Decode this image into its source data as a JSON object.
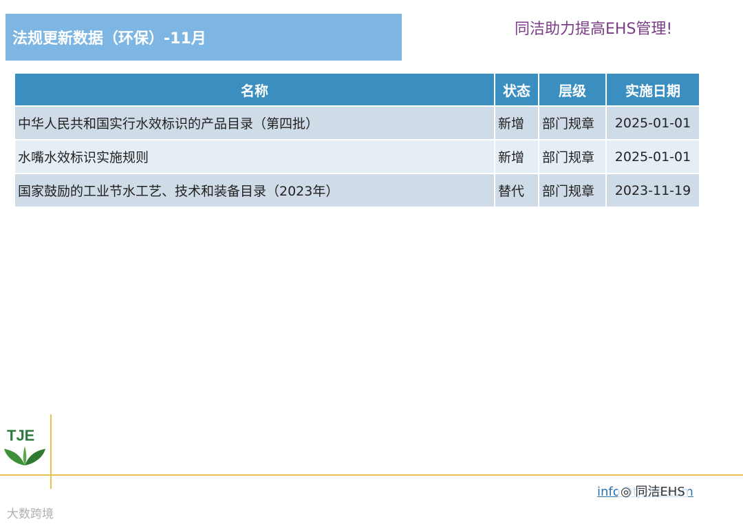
{
  "header": {
    "title": "法规更新数据（环保）-11月",
    "slogan": "同洁助力提高EHS管理!"
  },
  "table": {
    "headers": {
      "name": "名称",
      "status": "状态",
      "level": "层级",
      "date": "实施日期"
    },
    "rows": [
      {
        "name": "中华人民共和国实行水效标识的产品目录（第四批）",
        "status": "新增",
        "level": "部门规章",
        "date": "2025-01-01"
      },
      {
        "name": "水嘴水效标识实施规则",
        "status": "新增",
        "level": "部门规章",
        "date": "2025-01-01"
      },
      {
        "name": "国家鼓励的工业节水工艺、技术和装备目录（2023年）",
        "status": "替代",
        "level": "部门规章",
        "date": "2023-11-19"
      }
    ]
  },
  "footer": {
    "logo_text": "TJE",
    "link_text": "info@tjehs.com",
    "watermark_right": "◎ 同洁EHS",
    "watermark_left": "大数跨境"
  },
  "colors": {
    "title_bg": "#7db6e3",
    "header_bg": "#3b8fc0",
    "slogan": "#7a3d86",
    "rule_line": "#e8c24a",
    "logo_green": "#2c7a3c"
  }
}
